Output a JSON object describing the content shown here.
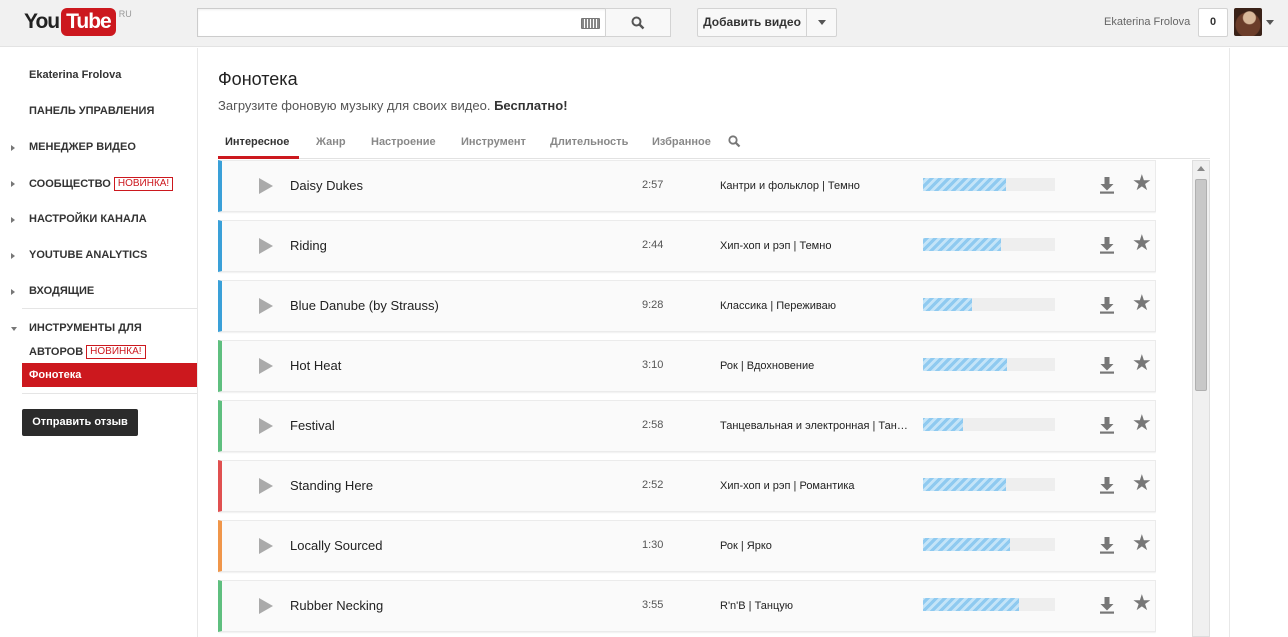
{
  "masthead": {
    "logo_you": "You",
    "logo_tube": "Tube",
    "logo_country": "RU",
    "search_placeholder": "",
    "upload_label": "Добавить видео",
    "username": "Ekaterina Frolova",
    "notifications_count": "0"
  },
  "sidebar": {
    "channel_name": "Ekaterina Frolova",
    "items": [
      {
        "label": "ПАНЕЛЬ УПРАВЛЕНИЯ"
      },
      {
        "label": "МЕНЕДЖЕР ВИДЕО"
      },
      {
        "label": "СООБЩЕСТВО",
        "badge": "НОВИНКА!"
      },
      {
        "label": "НАСТРОЙКИ КАНАЛА"
      },
      {
        "label": "YOUTUBE ANALYTICS"
      },
      {
        "label": "ВХОДЯЩИЕ"
      },
      {
        "label": "ИНСТРУМЕНТЫ ДЛЯ",
        "label2": "АВТОРОВ",
        "badge": "НОВИНКА!"
      }
    ],
    "active_item": "Фонотека",
    "feedback_button": "Отправить отзыв"
  },
  "main": {
    "title": "Фонотека",
    "subtitle": "Загрузите фоновую музыку для своих видео.",
    "subtitle_bold": "Бесплатно!",
    "tabs": [
      "Интересное",
      "Жанр",
      "Настроение",
      "Инструмент",
      "Длительность",
      "Избранное"
    ],
    "active_tab": "Интересное",
    "tracks": [
      {
        "title": "Daisy Dukes",
        "duration": "2:57",
        "genre": "Кантри и фольклор | Темно",
        "popularity": 0.63,
        "color": "#3aa0d8"
      },
      {
        "title": "Riding",
        "duration": "2:44",
        "genre": "Хип-хоп и рэп | Темно",
        "popularity": 0.59,
        "color": "#3aa0d8"
      },
      {
        "title": "Blue Danube (by Strauss)",
        "duration": "9:28",
        "genre": "Классика | Переживаю",
        "popularity": 0.37,
        "color": "#3aa0d8"
      },
      {
        "title": "Hot Heat",
        "duration": "3:10",
        "genre": "Рок | Вдохновение",
        "popularity": 0.64,
        "color": "#5fbf7f"
      },
      {
        "title": "Festival",
        "duration": "2:58",
        "genre": "Танцевальная и электронная | Тан…",
        "popularity": 0.3,
        "color": "#5fbf7f"
      },
      {
        "title": "Standing Here",
        "duration": "2:52",
        "genre": "Хип-хоп и рэп | Романтика",
        "popularity": 0.63,
        "color": "#e05050"
      },
      {
        "title": "Locally Sourced",
        "duration": "1:30",
        "genre": "Рок | Ярко",
        "popularity": 0.66,
        "color": "#f0964a"
      },
      {
        "title": "Rubber Necking",
        "duration": "3:55",
        "genre": "R'n'B | Танцую",
        "popularity": 0.73,
        "color": "#5fbf7f"
      }
    ]
  }
}
